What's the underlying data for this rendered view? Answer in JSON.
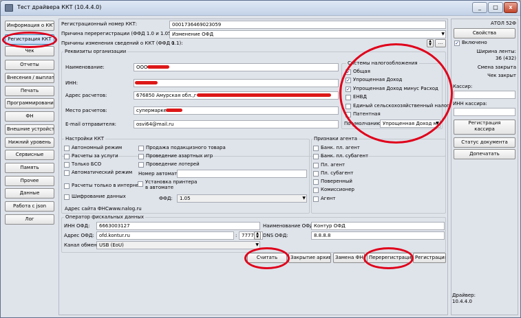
{
  "window": {
    "title": "Тест драйвера ККТ (10.4.4.0)",
    "min": "_",
    "max": "□",
    "close": "x"
  },
  "sidebar": {
    "items": [
      {
        "label": "Информация о ККТ"
      },
      {
        "label": "Регистрация ККТ"
      },
      {
        "label": "Чек"
      },
      {
        "label": "Отчеты"
      },
      {
        "label": "Внесения / выплаты"
      },
      {
        "label": "Печать"
      },
      {
        "label": "Программирование"
      },
      {
        "label": "ФН"
      },
      {
        "label": "Внешние устройства"
      },
      {
        "label": "Нижний уровень"
      },
      {
        "label": "Сервисные"
      },
      {
        "label": "Память"
      },
      {
        "label": "Прочее"
      },
      {
        "label": "Данные"
      },
      {
        "label": "Работа с json"
      },
      {
        "label": "Лог"
      }
    ]
  },
  "top": {
    "reg_number_label": "Регистрационный номер ККТ:",
    "reg_number_value": "0001736469023059",
    "rereg_reason_label": "Причина перерегистрации (ФФД 1.0 и 1.05):",
    "rereg_reason_value": "Изменение ОФД",
    "change_reasons_label": "Причины изменения сведений о ККТ (ФФД 1.1):",
    "change_reasons_value": "0",
    "spin_up": "▲",
    "spin_down": "▼",
    "more": "..."
  },
  "org": {
    "group_title": "Реквизиты организации",
    "name_label": "Наименование:",
    "name_value": "ООО",
    "inn_label": "ИНН:",
    "address_label": "Адрес расчетов:",
    "address_value": "676850 Амурская обл.,г",
    "place_label": "Место расчетов:",
    "place_value": "супермаркет",
    "email_label": "E-mail отправителя:",
    "email_value": "osvi64@mail.ru"
  },
  "tax": {
    "group_title": "Системы налогообложения",
    "items": [
      {
        "label": "Общая",
        "checked": "✓"
      },
      {
        "label": "Упрощенная Доход",
        "checked": "✓"
      },
      {
        "label": "Упрощенная Доход минус Расход",
        "checked": "✓"
      },
      {
        "label": "ЕНВД",
        "checked": ""
      },
      {
        "label": "Единый сельскохозяйственный налог",
        "checked": ""
      },
      {
        "label": "Патентная",
        "checked": ""
      }
    ],
    "default_label": "По умолчанию:",
    "default_value": "Упрощенная Доход м"
  },
  "kkt": {
    "group_title": "Настройки ККТ",
    "left": [
      {
        "label": "Автономный режим",
        "checked": ""
      },
      {
        "label": "Расчеты за услуги",
        "checked": ""
      },
      {
        "label": "Только БСО",
        "checked": ""
      },
      {
        "label": "Автоматический режим",
        "checked": ""
      },
      {
        "label": "Расчеты только в интернет",
        "checked": ""
      },
      {
        "label": "Шифрование данных",
        "checked": ""
      }
    ],
    "right": [
      {
        "label": "Продажа подакцизного товара",
        "checked": ""
      },
      {
        "label": "Проведение азартных игр",
        "checked": ""
      },
      {
        "label": "Проведение лотерей",
        "checked": ""
      }
    ],
    "automat_label": "Номер автомата:",
    "printer_label_1": "Установка принтера",
    "printer_label_2": "в автомате",
    "ffd_label": "ФФД:",
    "ffd_value": "1.05",
    "fns_label": "Адрес сайта ФНС:",
    "fns_value": "www.nalog.ru"
  },
  "agent": {
    "group_title": "Признаки агента",
    "items": [
      {
        "label": "Банк. пл. агент",
        "checked": ""
      },
      {
        "label": "Банк. пл. субагент",
        "checked": ""
      },
      {
        "label": "Пл. агент",
        "checked": ""
      },
      {
        "label": "Пл. субагент",
        "checked": ""
      },
      {
        "label": "Поверенный",
        "checked": ""
      },
      {
        "label": "Комиссионер",
        "checked": ""
      },
      {
        "label": "Агент",
        "checked": ""
      }
    ]
  },
  "ofd": {
    "group_title": "Оператор фискальных данных",
    "inn_label": "ИНН ОФД:",
    "inn_value": "6663003127",
    "name_label": "Наименование ОФД:",
    "name_value": "Контур ОФД",
    "address_label": "Адрес ОФД:",
    "address_value": "ofd.kontur.ru",
    "port_sep": ":",
    "port_value": "7777",
    "dns_label": "DNS ОФД:",
    "dns_value": "8.8.8.8",
    "channel_label": "Канал обмена:",
    "channel_value": "USB (EoU)"
  },
  "actions": {
    "read": "Считать",
    "close_archive": "Закрытие архива",
    "replace_fn": "Замена ФН",
    "reregister": "Перерегистрация",
    "register": "Регистрация"
  },
  "right": {
    "device": "АТОЛ 52Ф",
    "properties": "Свойства",
    "enabled_label": "Включено",
    "enabled_checked": "✓",
    "tape_width_label": "Ширина ленты:",
    "tape_width_value": "36 (432)",
    "shift_status": "Смена закрыта",
    "receipt_status": "Чек закрыт",
    "cashier_label": "Кассир:",
    "cashier_inn_label": "ИНН кассира:",
    "register_cashier_1": "Регистрация",
    "register_cashier_2": "кассира",
    "doc_status": "Статус документа",
    "reprint": "Допечатать",
    "driver_label": "Драйвер:",
    "driver_version": "10.4.4.0"
  }
}
